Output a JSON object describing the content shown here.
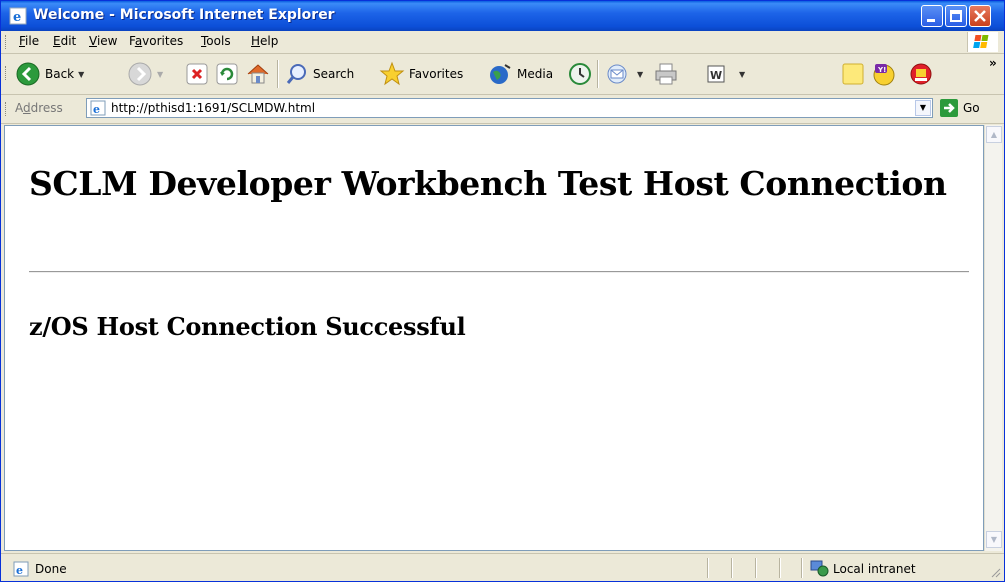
{
  "window": {
    "title": "Welcome - Microsoft Internet Explorer"
  },
  "menu": {
    "items": [
      {
        "label": "File",
        "underline": "F",
        "rest": "ile"
      },
      {
        "label": "Edit",
        "underline": "E",
        "rest": "dit"
      },
      {
        "label": "View",
        "underline": "V",
        "rest": "iew"
      },
      {
        "label": "Favorites",
        "underline": "a",
        "pre": "F",
        "rest": "vorites"
      },
      {
        "label": "Tools",
        "underline": "T",
        "rest": "ools"
      },
      {
        "label": "Help",
        "underline": "H",
        "rest": "elp"
      }
    ]
  },
  "toolbar": {
    "back_label": "Back",
    "search_label": "Search",
    "favorites_label": "Favorites",
    "media_label": "Media"
  },
  "address": {
    "label": "Address",
    "label_underline": "d",
    "url": "http://pthisd1:1691/SCLMDW.html",
    "go_label": "Go"
  },
  "page": {
    "heading": "SCLM Developer Workbench Test Host Connection",
    "subheading": "z/OS Host Connection Successful"
  },
  "status": {
    "text": "Done",
    "zone": "Local intranet"
  },
  "colors": {
    "titlebar": "#0c4fd8",
    "chrome": "#ece9d8",
    "close_button": "#c8401e"
  }
}
